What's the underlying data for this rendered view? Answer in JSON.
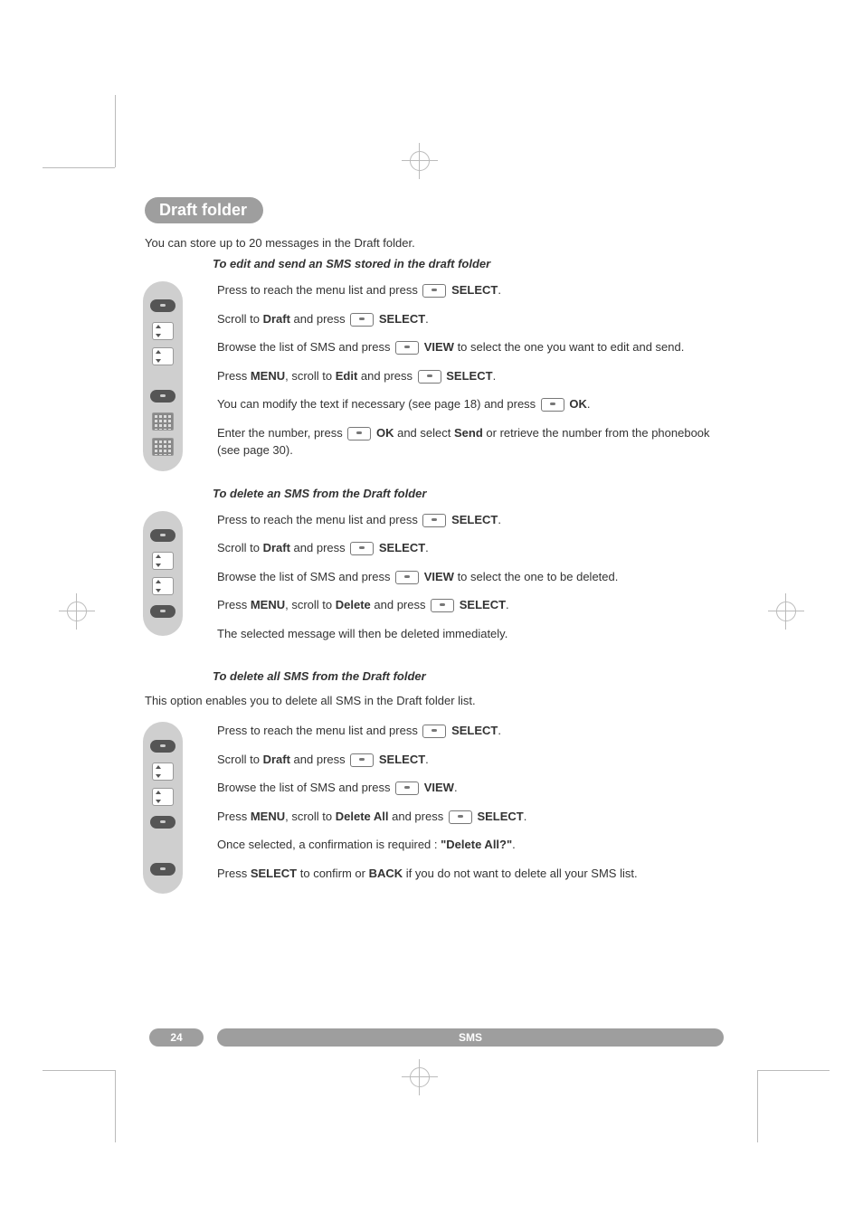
{
  "header": {
    "title": "Draft folder"
  },
  "intro": "You can store up to 20 messages in the Draft folder.",
  "procs": [
    {
      "title": "To edit and send an SMS stored in the draft folder",
      "icons": [
        "btn",
        "nav",
        "nav",
        "btn",
        "kpad",
        "kpad"
      ],
      "steps": [
        {
          "pre": "Press to reach the menu list and press ",
          "key": true,
          "post": "SELECT",
          "tail": "."
        },
        {
          "pre": "Scroll to ",
          "bold1": "Draft",
          "mid1": " and press ",
          "key": true,
          "post": "SELECT",
          "tail": "."
        },
        {
          "pre": "Browse the list of SMS and press ",
          "key": true,
          "post": "VIEW",
          "tail": " to select the one you want to edit and send."
        },
        {
          "pre": "Press ",
          "bold1": "MENU",
          "mid1": ", scroll to ",
          "bold2": "Edit",
          "mid2": " and press ",
          "key": true,
          "post": "SELECT",
          "tail": "."
        },
        {
          "pre": "You can modify the text if necessary (see page 18) and press ",
          "key": true,
          "post": "OK",
          "tail": "."
        },
        {
          "pre": "Enter the number, press ",
          "key": true,
          "post": "OK",
          "tail_cont": " and select ",
          "bold3": "Send",
          "tail2": " or retrieve the number from the phonebook (see page 30)."
        }
      ]
    },
    {
      "title": "To delete an SMS from the Draft folder",
      "icons": [
        "btn",
        "nav",
        "nav",
        "btn"
      ],
      "steps": [
        {
          "pre": "Press to reach the menu list and press ",
          "key": true,
          "post": "SELECT",
          "tail": "."
        },
        {
          "pre": "Scroll to ",
          "bold1": "Draft",
          "mid1": " and press ",
          "key": true,
          "post": "SELECT",
          "tail": "."
        },
        {
          "pre": "Browse the list of SMS and press ",
          "key": true,
          "post": "VIEW",
          "tail": " to select the one to be deleted."
        },
        {
          "pre": "Press ",
          "bold1": "MENU",
          "mid1": ", scroll to ",
          "bold2": "Delete",
          "mid2": " and press ",
          "key": true,
          "post": "SELECT",
          "tail": "."
        },
        {
          "pre": "The selected message will then be deleted immediately."
        }
      ]
    },
    {
      "title": "To delete all SMS from the Draft folder",
      "intro": "This option enables you to delete all SMS in the Draft folder list.",
      "icons": [
        "btn",
        "nav",
        "nav",
        "btn",
        "",
        "btn"
      ],
      "steps": [
        {
          "pre": "Press to reach the menu list and press ",
          "key": true,
          "post": "SELECT",
          "tail": "."
        },
        {
          "pre": "Scroll to ",
          "bold1": "Draft",
          "mid1": " and press ",
          "key": true,
          "post": "SELECT",
          "tail": "."
        },
        {
          "pre": "Browse the list of SMS and press ",
          "key": true,
          "post": "VIEW",
          "tail": "."
        },
        {
          "pre": "Press ",
          "bold1": "MENU",
          "mid1": ", scroll to ",
          "bold2": "Delete All",
          "mid2": " and press ",
          "key": true,
          "post": "SELECT",
          "tail": "."
        },
        {
          "pre": "Once selected, a confirmation is required : ",
          "bold1": "\"Delete All?\"",
          "tail": "."
        },
        {
          "pre": "Press ",
          "bold1": "SELECT",
          "mid1": " to confirm or ",
          "bold2": "BACK",
          "mid2": " if you do not want to delete all your SMS list."
        }
      ]
    }
  ],
  "footer": {
    "page": "24",
    "label": "SMS"
  }
}
